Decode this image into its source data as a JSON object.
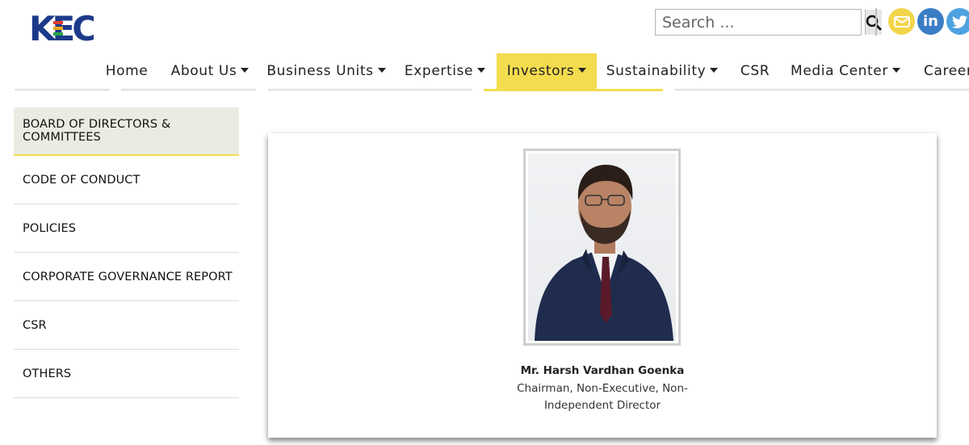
{
  "header": {
    "logo_text": "KEC",
    "search": {
      "placeholder": "Search ...",
      "value": ""
    },
    "social": [
      "mail-icon",
      "linkedin-icon",
      "twitter-icon"
    ],
    "linkedin_text": "in"
  },
  "nav": {
    "items": [
      {
        "label": "Home",
        "dropdown": false
      },
      {
        "label": "About Us",
        "dropdown": true
      },
      {
        "label": "Business Units",
        "dropdown": true
      },
      {
        "label": "Expertise",
        "dropdown": true
      },
      {
        "label": "Investors",
        "dropdown": true,
        "active": true
      },
      {
        "label": "Sustainability",
        "dropdown": true
      },
      {
        "label": "CSR",
        "dropdown": false
      },
      {
        "label": "Media Center",
        "dropdown": true
      },
      {
        "label": "Career",
        "dropdown": false
      }
    ]
  },
  "sidebar": {
    "items": [
      {
        "label": "BOARD OF DIRECTORS & COMMITTEES",
        "active": true
      },
      {
        "label": "CODE OF CONDUCT"
      },
      {
        "label": "POLICIES"
      },
      {
        "label": "CORPORATE GOVERNANCE REPORT"
      },
      {
        "label": "CSR"
      },
      {
        "label": "OTHERS"
      }
    ]
  },
  "director": {
    "name": "Mr. Harsh Vardhan Goenka",
    "title": "Chairman, Non-Executive, Non-Independent Director"
  },
  "colors": {
    "accent": "#f4dc4f",
    "brand_blue": "#1d3a8a",
    "sidebar_active_bg": "#ecebe1"
  }
}
